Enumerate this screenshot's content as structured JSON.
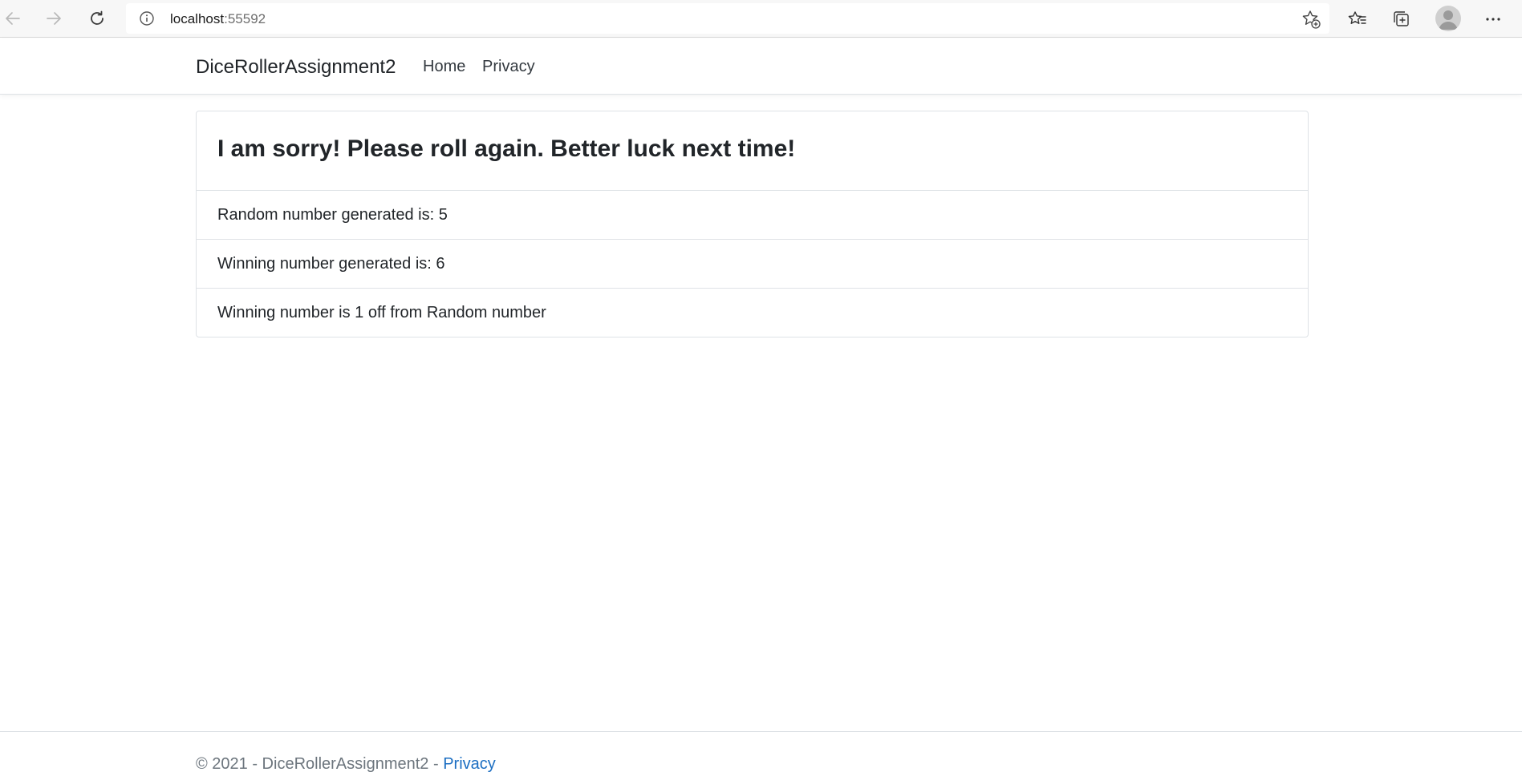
{
  "browser": {
    "url_host": "localhost",
    "url_port": ":55592"
  },
  "site_nav": {
    "brand": "DiceRollerAssignment2",
    "links": [
      "Home",
      "Privacy"
    ]
  },
  "result_card": {
    "title": "I am sorry! Please roll again. Better luck next time!",
    "items": [
      "Random number generated is: 5",
      "Winning number generated is: 6",
      "Winning number is 1 off from Random number"
    ]
  },
  "footer": {
    "text": "© 2021 - DiceRollerAssignment2 - ",
    "privacy_link": "Privacy"
  },
  "colors": {
    "link_blue": "#1b6ec2",
    "muted_gray": "#6c757d",
    "border": "#dee2e6"
  }
}
